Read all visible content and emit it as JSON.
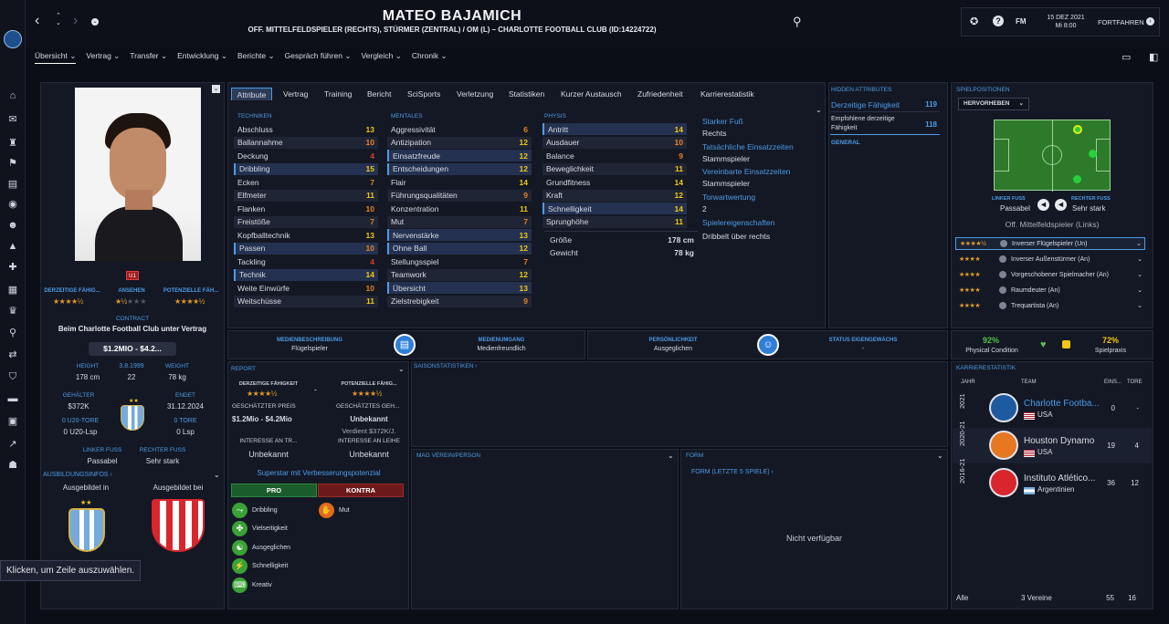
{
  "header": {
    "name": "MATEO BAJAMICH",
    "subtitle": "OFF. MITTELFELDSPIELER (RECHTS), STÜRMER (ZENTRAL) / OM (L) – CHARLOTTE FOOTBALL CLUB (ID:14224722)",
    "date": "15 DEZ 2021",
    "time": "Mi 8:00",
    "continue": "FORTFAHREN",
    "fm": "FM"
  },
  "menu": [
    "Übersicht",
    "Vertrag",
    "Transfer",
    "Entwicklung",
    "Berichte",
    "Gespräch führen",
    "Vergleich",
    "Chronik"
  ],
  "tabs": [
    "Attribute",
    "Vertrag",
    "Training",
    "Bericht",
    "SciSports",
    "Verletzung",
    "Statistiken",
    "Kurzer Austausch",
    "Zufriedenheit",
    "Karrierestatistik"
  ],
  "profile": {
    "badge": "U1",
    "cur_label": "DERZEITIGE FÄHIG...",
    "rep_label": "ANSEHEN",
    "pot_label": "POTENZIELLE FÄH...",
    "cur_stars": "★★★★½",
    "rep_stars": "★½",
    "rep_empty": "★★★",
    "pot_stars": "★★★★½",
    "contract_label": "CONTRACT",
    "contract_text": "Beim Charlotte Football Club unter Vertrag",
    "price": "$1.2MIO - $4.2...",
    "height_label": "HEIGHT",
    "height": "178 cm",
    "dob": "3.8.1999",
    "age": "22",
    "weight_label": "WEIGHT",
    "weight": "78 kg",
    "salary_label": "GEHÄLTER",
    "salary": "$372K",
    "ends_label": "ENDET",
    "ends": "31.12.2024",
    "u20_label": "0 U20-TORE",
    "u20": "0 U20-Lsp",
    "goals_label": "0 TORE",
    "caps": "0 Lsp",
    "lfoot_label": "LINKER FUSS",
    "lfoot": "Passabel",
    "rfoot_label": "RECHTER FUSS",
    "rfoot": "Sehr stark",
    "training_label": "AUSBILDUNGSINFOS",
    "trained_in": "Ausgebildet in",
    "trained_at": "Ausgebildet bei",
    "tooltip": "Klicken, um Zeile auszuwählen."
  },
  "tech": {
    "title": "TECHNIKEN",
    "rows": [
      [
        "Abschluss",
        "13",
        "y"
      ],
      [
        "Ballannahme",
        "10",
        "o"
      ],
      [
        "Deckung",
        "4",
        "r"
      ],
      [
        "Dribbling",
        "15",
        "y"
      ],
      [
        "Ecken",
        "7",
        "o"
      ],
      [
        "Elfmeter",
        "11",
        "y"
      ],
      [
        "Flanken",
        "10",
        "o"
      ],
      [
        "Freistöße",
        "7",
        "o"
      ],
      [
        "Kopfballtechnik",
        "13",
        "y"
      ],
      [
        "Passen",
        "10",
        "o"
      ],
      [
        "Tackling",
        "4",
        "r"
      ],
      [
        "Technik",
        "14",
        "y"
      ],
      [
        "Weite Einwürfe",
        "10",
        "o"
      ],
      [
        "Weitschüsse",
        "11",
        "y"
      ]
    ]
  },
  "ment": {
    "title": "MENTALES",
    "rows": [
      [
        "Aggressivität",
        "6",
        "o"
      ],
      [
        "Antizipation",
        "12",
        "y"
      ],
      [
        "Einsatzfreude",
        "12",
        "y"
      ],
      [
        "Entscheidungen",
        "12",
        "y"
      ],
      [
        "Flair",
        "14",
        "y"
      ],
      [
        "Führungsqualitäten",
        "9",
        "o"
      ],
      [
        "Konzentration",
        "11",
        "y"
      ],
      [
        "Mut",
        "7",
        "o"
      ],
      [
        "Nervenstärke",
        "13",
        "y"
      ],
      [
        "Ohne Ball",
        "12",
        "y"
      ],
      [
        "Stellungsspiel",
        "7",
        "o"
      ],
      [
        "Teamwork",
        "12",
        "y"
      ],
      [
        "Übersicht",
        "13",
        "y"
      ],
      [
        "Zielstrebigkeit",
        "9",
        "o"
      ]
    ]
  },
  "phys": {
    "title": "PHYSIS",
    "rows": [
      [
        "Antritt",
        "14",
        "y"
      ],
      [
        "Ausdauer",
        "10",
        "o"
      ],
      [
        "Balance",
        "9",
        "o"
      ],
      [
        "Beweglichkeit",
        "11",
        "y"
      ],
      [
        "Grundfitness",
        "14",
        "y"
      ],
      [
        "Kraft",
        "12",
        "y"
      ],
      [
        "Schnelligkeit",
        "14",
        "y"
      ],
      [
        "Sprunghöhe",
        "11",
        "y"
      ]
    ],
    "height_l": "Größe",
    "height": "178 cm",
    "weight_l": "Gewicht",
    "weight": "78 kg"
  },
  "info": {
    "foot_l": "Starker Fuß",
    "foot": "Rechts",
    "act_l": "Tatsächliche Einsatzzeiten",
    "act": "Stammspieler",
    "agr_l": "Vereinbarte Einsatzzeiten",
    "agr": "Stammspieler",
    "gk_l": "Torwartwertung",
    "gk": "2",
    "traits_l": "Spielereigenschaften",
    "traits": "Dribbelt über rechts"
  },
  "hidden": {
    "title": "HIDDEN ATTRIBUTES",
    "cur_l": "Derzeitige Fähigkeit",
    "cur": "119",
    "rec_l": "Empfohlene derzeitige Fähigkeit",
    "rec": "118",
    "gen": "GENERAL"
  },
  "positions": {
    "title": "SPIELPOSITIONEN",
    "dropdown": "HERVORHEBEN",
    "lf_l": "LINKER FUSS",
    "lf": "Passabel",
    "rf_l": "RECHTER FUSS",
    "rf": "Sehr stark",
    "pos": "Off. Mittelfeldspieler (Links)",
    "roles": [
      [
        "★★★★½",
        "Inverser Flügelspieler (Un)"
      ],
      [
        "★★★★",
        "Inverser Außenstürmer (An)"
      ],
      [
        "★★★★",
        "Vorgeschobener Spielmacher (An)"
      ],
      [
        "★★★★",
        "Raumdeuter (An)"
      ],
      [
        "★★★★",
        "Trequartista (An)"
      ]
    ]
  },
  "cond": {
    "pc": "92%",
    "pc_l": "Physical Condition",
    "mp": "72%",
    "mp_l": "Spielpraxis"
  },
  "media": {
    "desc_l": "MEDIENBESCHREIBUNG",
    "desc": "Flügelspieler",
    "handle_l": "MEDIENUMGANG",
    "handle": "Medienfreundlich",
    "pers_l": "PERSÖNLICHKEIT",
    "pers": "Ausgeglichen",
    "home_l": "STATUS EIGENGEWÄCHS",
    "home": "-"
  },
  "report": {
    "title": "REPORT",
    "cur_l": "DERZEITIGE FÄHIGKEIT",
    "pot_l": "POTENZIELLE FÄHIG...",
    "cur": "★★★★½",
    "pot": "★★★★½",
    "dash": "-",
    "price_l": "GESCHÄTZTER PREIS",
    "price": "$1.2Mio - $4.2Mio",
    "sal_l": "GESCHÄTZTES GEH...",
    "sal": "Unbekannt",
    "sal2": "Verdient $372K/J.",
    "int_l": "INTERESSE AN TR...",
    "int": "Unbekannt",
    "int2_l": "INTERESSE AN LEIHE",
    "int2": "Unbekannt",
    "sum": "Superstar mit Verbesserungspotenzial",
    "pro": "PRO",
    "con": "KONTRA",
    "pros": [
      "Dribbling",
      "Vielseitigkeit",
      "Ausgeglichen",
      "Schnelligkeit",
      "Kreativ"
    ],
    "cons": [
      "Mut"
    ]
  },
  "season": {
    "title": "SAISONSTATISTIKEN"
  },
  "fav": {
    "title": "MAG VEREIN/PERSON"
  },
  "form": {
    "title": "FORM",
    "sub": "FORM (LETZTE 5 SPIELE)",
    "na": "Nicht verfügbar"
  },
  "career": {
    "title": "KARRIERESTATISTIK",
    "h_year": "JAHR",
    "h_team": "TEAM",
    "h_apps": "EINS...",
    "h_goals": "TORE",
    "rows": [
      [
        "2021",
        "Charlotte Footba...",
        "USA",
        "0",
        "-"
      ],
      [
        "2020-21",
        "Houston Dynamo",
        "USA",
        "19",
        "4"
      ],
      [
        "2016-21",
        "Instituto Atlético...",
        "Argentinien",
        "36",
        "12"
      ]
    ],
    "all": "Alle",
    "clubs": "3 Vereine",
    "apps": "55",
    "goals": "16"
  },
  "colors": {
    "accent": "#4c9be8",
    "good": "#f2c814",
    "mid": "#e8841e",
    "bad": "#e23a2c"
  }
}
